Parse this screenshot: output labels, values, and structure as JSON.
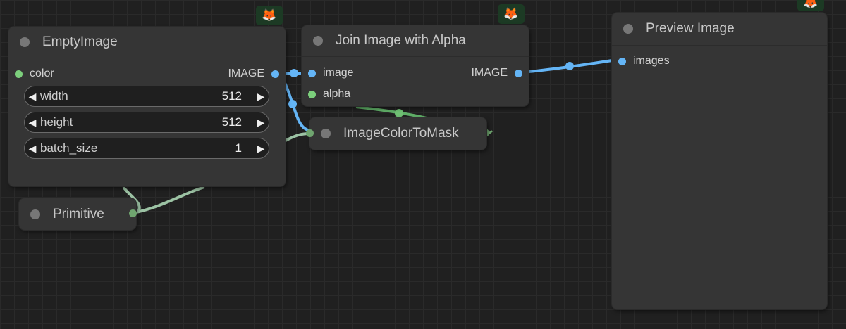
{
  "nodes": {
    "empty_image": {
      "title": "EmptyImage",
      "input_color": "color",
      "output": "IMAGE",
      "widgets": [
        {
          "label": "width",
          "value": "512"
        },
        {
          "label": "height",
          "value": "512"
        },
        {
          "label": "batch_size",
          "value": "1"
        }
      ]
    },
    "join_alpha": {
      "title": "Join Image with Alpha",
      "input_image": "image",
      "input_alpha": "alpha",
      "output": "IMAGE"
    },
    "color_to_mask": {
      "title": "ImageColorToMask"
    },
    "primitive": {
      "title": "Primitive"
    },
    "preview": {
      "title": "Preview Image",
      "input_images": "images"
    }
  },
  "badge_icon": "🦊",
  "colors": {
    "canvas": "#202020",
    "node_bg": "#353535",
    "image_link": "#64b5f6",
    "mask_link": "#6fbf73",
    "primitive_link": "#8fb59a"
  }
}
